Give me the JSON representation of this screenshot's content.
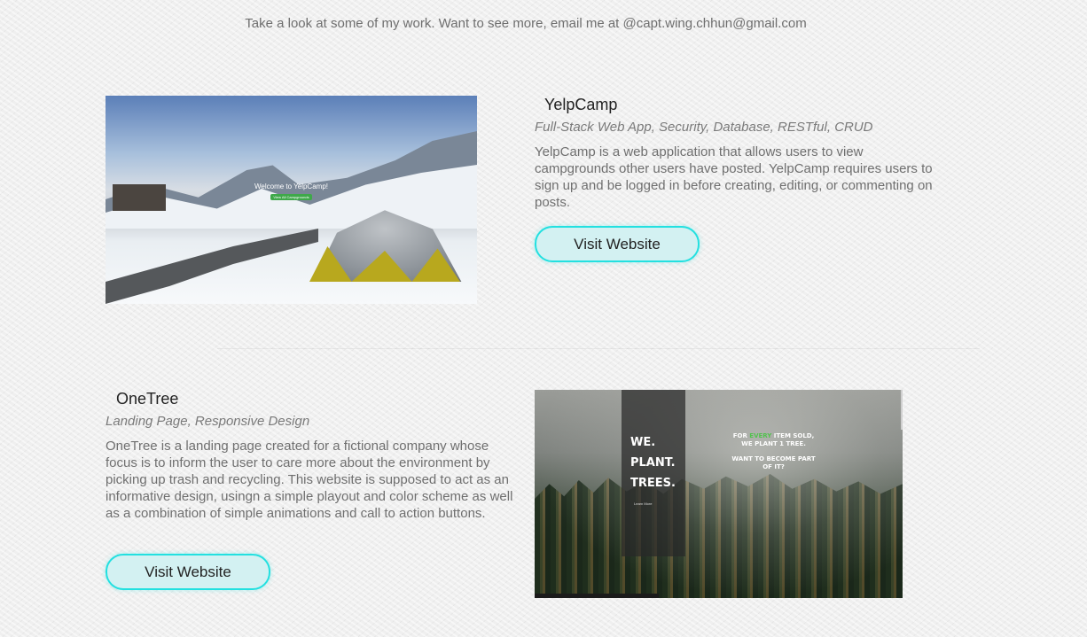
{
  "intro": {
    "text": "Take a look at some of my work. Want to see more, email me at @capt.wing.chhun@gmail.com"
  },
  "projects": [
    {
      "title": "YelpCamp",
      "tags": "Full-Stack Web App, Security, Database, RESTful, CRUD",
      "description": "YelpCamp is a web application that allows users to view campgrounds other users have posted. YelpCamp requires users to sign up and be logged in before creating, editing, or commenting on posts.",
      "button_label": "Visit Website",
      "preview": {
        "welcome_text": "Welcome to YelpCamp!",
        "button_text": "View All Campgrounds"
      }
    },
    {
      "title": "OneTree",
      "tags": "Landing Page, Responsive Design",
      "description": "OneTree is a landing page created for a fictional company whose focus is to inform the user to care more about the environment by picking up trash and recycling. This website is supposed to act as an informative design, usingn a simple playout and color scheme as well as a combination of simple animations and call to action buttons.",
      "button_label": "Visit Website",
      "preview": {
        "headline_1": "WE.",
        "headline_2": "PLANT.",
        "headline_3": "TREES.",
        "learn_more": "Learn More",
        "side_pre": "FOR ",
        "side_green": "EVERY",
        "side_post": " ITEM SOLD, WE PLANT 1 TREE.",
        "side_question": "WANT TO BECOME PART OF IT?"
      }
    }
  ],
  "colors": {
    "accent_border": "#23e0e0",
    "button_fill": "#d3f1f2",
    "text_muted": "#6f6f6f",
    "tree_highlight": "#52c24e"
  }
}
